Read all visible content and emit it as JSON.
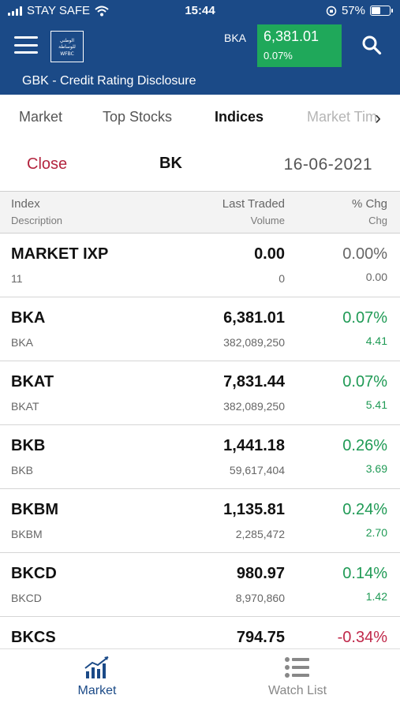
{
  "status_bar": {
    "carrier": "STAY SAFE",
    "time": "15:44",
    "battery": "57%",
    "battery_level": 0.57
  },
  "header": {
    "logo_text": "الوطني للوساطة WFBC",
    "ticker_symbol": "BKA",
    "ticker_price": "6,381.01",
    "ticker_change": "0.07%",
    "subtitle": "GBK - Credit Rating Disclosure",
    "colors": {
      "bar": "#1b4a87",
      "ticker_bg": "#1fa85a"
    }
  },
  "tabs": [
    {
      "label": "Market",
      "active": false
    },
    {
      "label": "Top Stocks",
      "active": false
    },
    {
      "label": "Indices",
      "active": true
    },
    {
      "label": "Market Time",
      "active": false
    }
  ],
  "toolbar": {
    "close_label": "Close",
    "exchange": "BK",
    "date": "16-06-2021"
  },
  "table": {
    "headers": {
      "index": "Index",
      "description": "Description",
      "last_traded": "Last Traded",
      "volume": "Volume",
      "pct_chg": "% Chg",
      "chg": "Chg"
    },
    "rows": [
      {
        "name": "MARKET IXP",
        "desc": "11",
        "last": "0.00",
        "volume": "0",
        "pct": "0.00%",
        "chg": "0.00",
        "dir": "flat"
      },
      {
        "name": "BKA",
        "desc": "BKA",
        "last": "6,381.01",
        "volume": "382,089,250",
        "pct": "0.07%",
        "chg": "4.41",
        "dir": "up"
      },
      {
        "name": "BKAT",
        "desc": "BKAT",
        "last": "7,831.44",
        "volume": "382,089,250",
        "pct": "0.07%",
        "chg": "5.41",
        "dir": "up"
      },
      {
        "name": "BKB",
        "desc": "BKB",
        "last": "1,441.18",
        "volume": "59,617,404",
        "pct": "0.26%",
        "chg": "3.69",
        "dir": "up"
      },
      {
        "name": "BKBM",
        "desc": "BKBM",
        "last": "1,135.81",
        "volume": "2,285,472",
        "pct": "0.24%",
        "chg": "2.70",
        "dir": "up"
      },
      {
        "name": "BKCD",
        "desc": "BKCD",
        "last": "980.97",
        "volume": "8,970,860",
        "pct": "0.14%",
        "chg": "1.42",
        "dir": "up"
      },
      {
        "name": "BKCS",
        "desc": "",
        "last": "794.75",
        "volume": "",
        "pct": "-0.34%",
        "chg": "",
        "dir": "down"
      }
    ],
    "colors": {
      "up": "#1f9a55",
      "down": "#c0284a",
      "flat": "#666666"
    }
  },
  "bottom_nav": [
    {
      "label": "Market",
      "icon": "bar-chart-icon",
      "active": true
    },
    {
      "label": "Watch List",
      "icon": "list-icon",
      "active": false
    }
  ]
}
